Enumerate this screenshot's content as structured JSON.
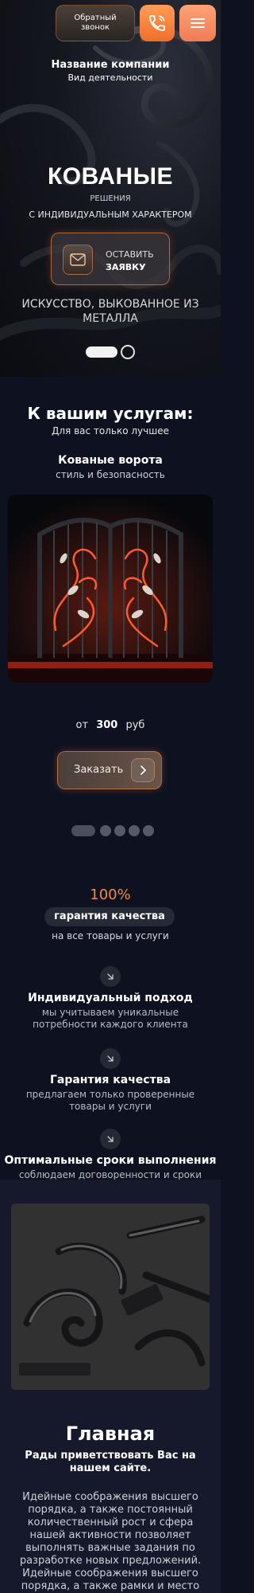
{
  "header": {
    "callback_label_1": "Обратный",
    "callback_label_2": "звонок",
    "phone_icon": "phone-icon",
    "menu_icon": "hamburger-menu-icon"
  },
  "company": {
    "name": "Название компании",
    "activity": "Вид деятельности"
  },
  "hero": {
    "title": "КОВАНЫЕ",
    "subtitle_1": "РЕШЕНИЯ",
    "subtitle_2": "С ИНДИВИДУАЛЬНЫМ ХАРАКТЕРОМ",
    "apply_line_1": "ОСТАВИТЬ",
    "apply_line_2": "ЗАЯВКУ",
    "slogan": "ИСКУССТВО, ВЫКОВАННОЕ ИЗ МЕТАЛЛА",
    "accent": "#f28a45"
  },
  "services": {
    "title": "К вашим услугам:",
    "subtitle": "Для вас только лучшее",
    "product": {
      "title": "Кованые ворота",
      "subtitle": "стиль и безопасность",
      "price_from": "от",
      "price_value": "300",
      "price_currency": "руб",
      "order_label": "Заказать"
    }
  },
  "advantages": {
    "percent": "100%",
    "badge": "гарантия качества",
    "badge_sub": "на все товары и услуги",
    "items": [
      {
        "title": "Индивидуальный подход",
        "text": "мы учитываем уникальные потребности каждого клиента"
      },
      {
        "title": "Гарантия качества",
        "text": "предлагаем только проверенные товары и услуги"
      },
      {
        "title": "Оптимальные сроки выполнения",
        "text": "соблюдаем договоренности и сроки"
      }
    ]
  },
  "home": {
    "title": "Главная",
    "subtitle": "Рады приветствовать Вас на нашем сайте.",
    "text": "Идейные соображения высшего порядка, а также постоянный количественный рост и сфера нашей активности позволяет выполнять важные задания по разработке новых предложений. Идейные соображения высшего порядка, а также рамки и место обучения кадров в"
  }
}
